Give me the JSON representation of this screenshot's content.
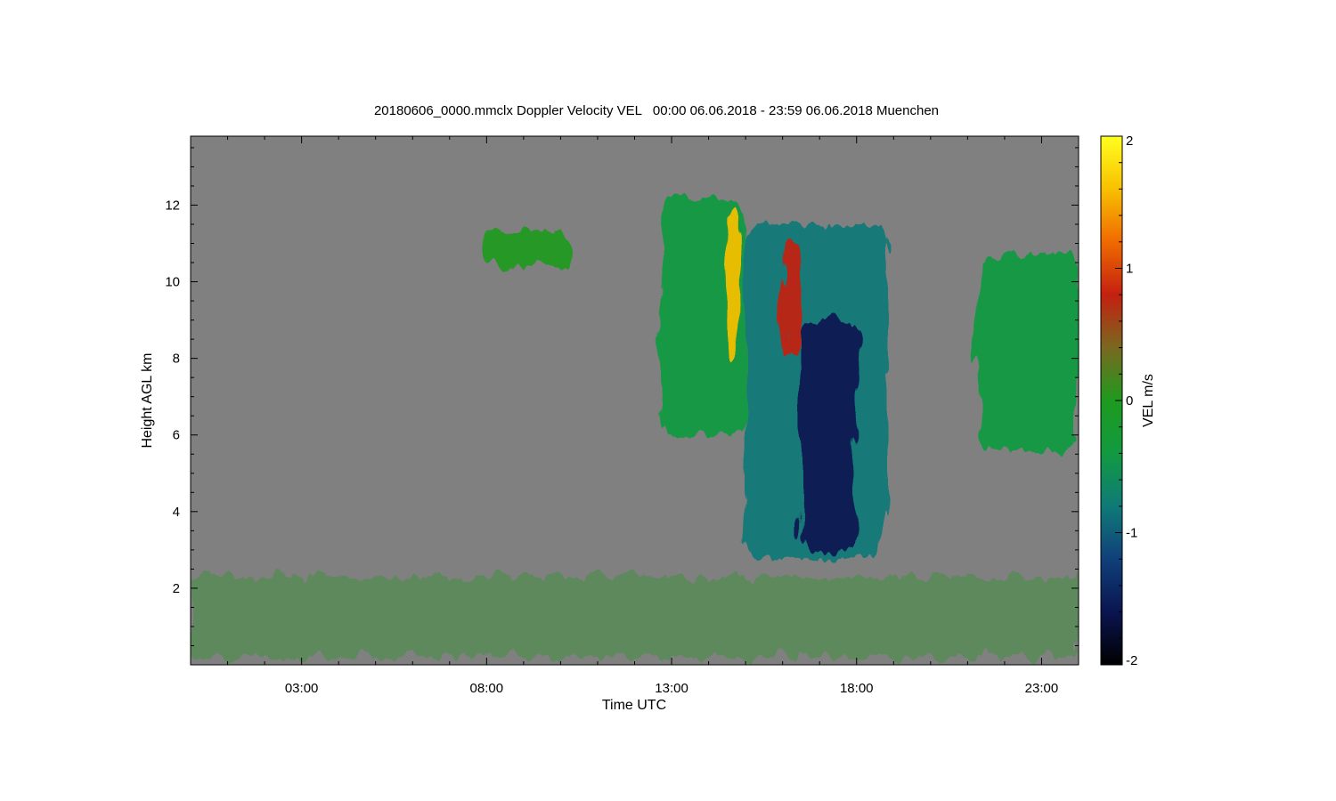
{
  "chart_data": {
    "type": "heatmap",
    "title": "20180606_0000.mmclx Doppler Velocity VEL   00:00 06.06.2018 - 23:59 06.06.2018 Muenchen",
    "xlabel": "Time UTC",
    "ylabel": "Height AGL km",
    "x_unit": "hour UTC",
    "xlim": [
      0.0,
      24.0
    ],
    "ylim": [
      0.0,
      13.8
    ],
    "x_ticks": [
      3,
      8,
      13,
      18,
      23
    ],
    "x_tick_labels": [
      "03:00",
      "08:00",
      "13:00",
      "18:00",
      "23:00"
    ],
    "y_ticks": [
      2,
      4,
      6,
      8,
      10,
      12
    ],
    "y_tick_labels": [
      "2",
      "4",
      "6",
      "8",
      "10",
      "12"
    ],
    "background_color": "#808080",
    "colorbar": {
      "label": "VEL m/s",
      "range": [
        -2,
        2
      ],
      "ticks": [
        -2,
        -1,
        0,
        1,
        2
      ],
      "tick_labels": [
        "-2",
        "-1",
        "0",
        "1",
        "2"
      ],
      "stops": [
        "#000000",
        "#0a1550",
        "#10407a",
        "#0f7a78",
        "#129a40",
        "#1e9a1e",
        "#7a6820",
        "#c42010",
        "#f06a00",
        "#f8c000",
        "#ffff20"
      ]
    },
    "regions": [
      {
        "name": "cirrus-morning",
        "t": [
          7.8,
          10.3
        ],
        "h": [
          10.4,
          11.3
        ],
        "vel": -0.2
      },
      {
        "name": "cloud-main-west",
        "t": [
          12.7,
          15.0
        ],
        "h": [
          6.0,
          12.2
        ],
        "vel": -0.6
      },
      {
        "name": "fallstreak-yellow",
        "t": [
          14.5,
          14.8
        ],
        "h": [
          8.0,
          12.0
        ],
        "vel": 1.6
      },
      {
        "name": "cloud-main-east",
        "t": [
          15.0,
          18.8
        ],
        "h": [
          2.8,
          11.5
        ],
        "vel": -0.8
      },
      {
        "name": "core-downdraft",
        "t": [
          16.5,
          18.0
        ],
        "h": [
          3.0,
          9.0
        ],
        "vel": -1.6
      },
      {
        "name": "updraft-red",
        "t": [
          16.0,
          16.5
        ],
        "h": [
          8.0,
          11.0
        ],
        "vel": 0.7
      },
      {
        "name": "cloud-evening",
        "t": [
          21.3,
          24.0
        ],
        "h": [
          5.6,
          10.7
        ],
        "vel": -0.3
      },
      {
        "name": "boundary-layer-echo",
        "t": [
          0.0,
          24.0
        ],
        "h": [
          0.2,
          2.3
        ],
        "vel": 0.0
      }
    ]
  }
}
